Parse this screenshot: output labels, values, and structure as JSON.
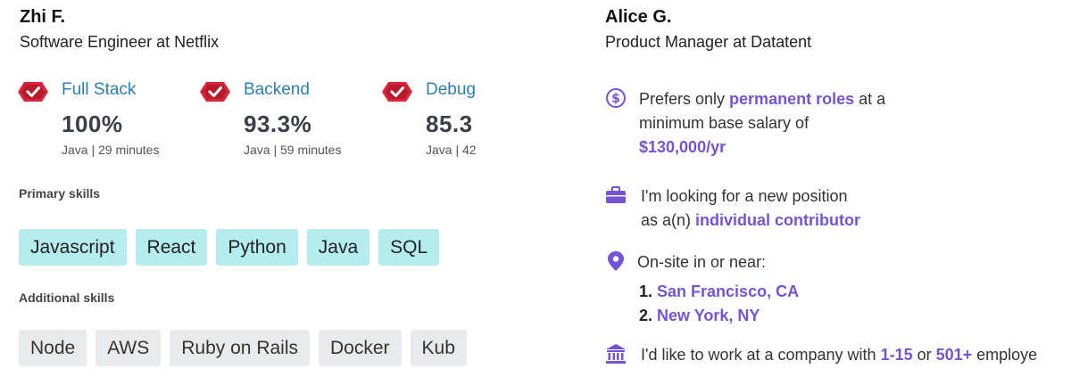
{
  "left_card": {
    "name": "Zhi F.",
    "role": "Software Engineer at Netflix",
    "assessments": [
      {
        "title": "Full Stack",
        "score": "100%",
        "meta": "Java | 29 minutes",
        "icon": "verified-badge-icon"
      },
      {
        "title": "Backend",
        "score": "93.3%",
        "meta": "Java | 59 minutes",
        "icon": "verified-badge-icon"
      },
      {
        "title": "Debug",
        "score": "85.3",
        "meta": "Java | 42",
        "icon": "verified-badge-icon"
      }
    ],
    "primary_skills_label": "Primary skills",
    "primary_skills": [
      "Javascript",
      "React",
      "Python",
      "Java",
      "SQL"
    ],
    "additional_skills_label": "Additional skills",
    "additional_skills": [
      "Node",
      "AWS",
      "Ruby on Rails",
      "Docker",
      "Kub"
    ]
  },
  "right_card": {
    "name": "Alice G.",
    "role": "Product Manager at Datatent",
    "salary": {
      "line1_prefix": "Prefers only ",
      "line1_highlight": "permanent roles",
      "line1_suffix": " at a",
      "line2": "minimum base salary of",
      "line3_highlight": "$130,000/yr"
    },
    "position": {
      "line1": "I'm looking for a new position",
      "line2_prefix": "as a(n) ",
      "line2_highlight": "individual contributor"
    },
    "location": {
      "label": "On-site in or near:",
      "items": [
        {
          "num": "1.",
          "city": "San Francisco, CA"
        },
        {
          "num": "2.",
          "city": "New York, NY"
        }
      ]
    },
    "company_size": {
      "prefix": "I'd like to work at a company with ",
      "size1": "1-15",
      "middle": " or ",
      "size2": "501+",
      "suffix": " employe"
    }
  },
  "colors": {
    "accent_blue": "#2b7fb0",
    "accent_purple": "#7553d6",
    "badge_red": "#d9253a",
    "chip_primary": "#b5ecee",
    "chip_secondary": "#e9eaec"
  }
}
